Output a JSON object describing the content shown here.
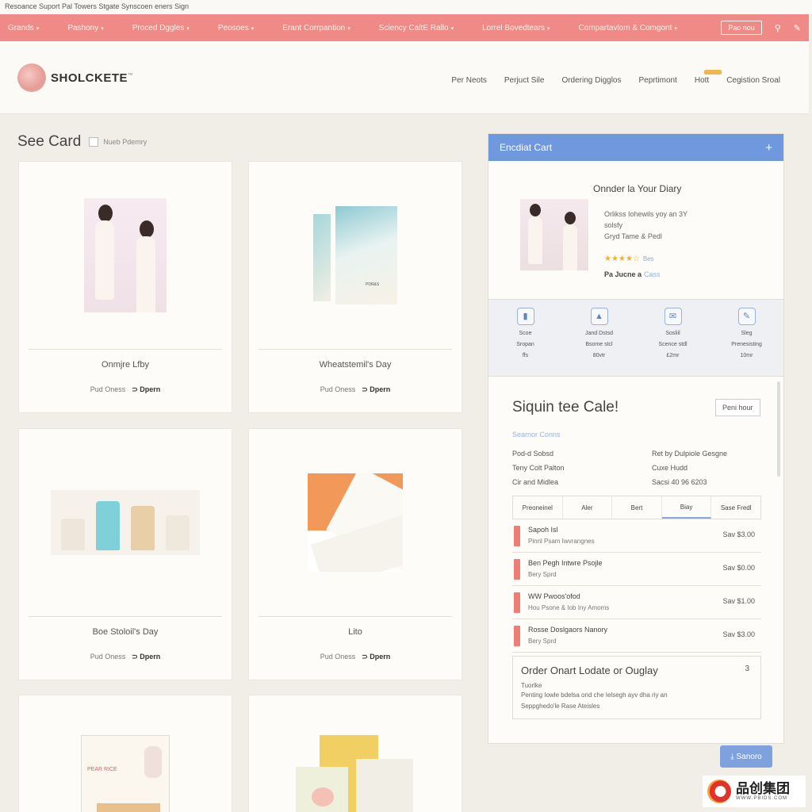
{
  "top_strip": "Resoance Suport Pal Towers Stgate Synscoen eners Sign",
  "nav": {
    "items": [
      "Grands",
      "Pashony",
      "Proced Dggles",
      "Peosoes",
      "Erant Corrpantion",
      "Sciency CaltE Rallo",
      "Lorrel Bovedtears",
      "Compartavlom & Comgont"
    ],
    "button": "Pao nou"
  },
  "header": {
    "logo": "SHOLCKETE",
    "links": [
      "Per Neots",
      "Perjuct Sile",
      "Ordering Digglos",
      "Peprtimont",
      "Hott",
      "Cegistion Sroal"
    ]
  },
  "section": {
    "title": "See Card",
    "subtitle": "Nueb Pdemry"
  },
  "cards": [
    {
      "title": "Onmjre Lfby",
      "foot": "Pud Oness",
      "foot_b": "Dpern"
    },
    {
      "title": "Wheatstemil's Day",
      "foot": "Pud Oness",
      "foot_b": "Dpern"
    },
    {
      "title": "Boe Stoloil's Day",
      "foot": "Pud Oness",
      "foot_b": "Dpern"
    },
    {
      "title": "Lito",
      "foot": "Pud Oness",
      "foot_b": "Dpern"
    },
    {
      "title": "",
      "foot": "",
      "foot_b": ""
    },
    {
      "title": "",
      "foot": "",
      "foot_b": ""
    }
  ],
  "card_misc": {
    "wedding_text": "PDR&S",
    "book_text": "PEAR RICE"
  },
  "panel": {
    "header": "Encdiat Cart",
    "order_title": "Onnder la Your Diary",
    "order_lines": [
      "Orlikss Iohewils yoy an 3Y",
      "solsfy",
      "Gryd Tame & Pedl"
    ],
    "stars": "★★★★☆",
    "rating_note": "Bes",
    "price_label": "Pa Jucne a",
    "price_value": "Cass",
    "steps": [
      {
        "icon": "document-icon",
        "glyph": "▮",
        "l1": "Scoe",
        "l2": "Sropan",
        "l3": "ffs"
      },
      {
        "icon": "image-icon",
        "glyph": "▲",
        "l1": "Jand Dstsd",
        "l2": "Bsome stcl",
        "l3": "80vtr"
      },
      {
        "icon": "mail-icon",
        "glyph": "✉",
        "l1": "Sosliil",
        "l2": "Scence stdl",
        "l3": "£2mr"
      },
      {
        "icon": "tool-icon",
        "glyph": "✎",
        "l1": "Sleg",
        "l2": "Prenesisting",
        "l3": "10mr"
      }
    ],
    "signup": {
      "title": "Siquin tee Cale!",
      "button": "Peni hour",
      "sub": "Searnor Conns",
      "left_rows": [
        "Pod-d Sobsd",
        "Teny Colt Palton",
        "Cir and Midlea"
      ],
      "right_rows": [
        "Ret by Dulpiole Gesgne",
        "Cuxe Hudd",
        "Sacsi 40 96 6203"
      ],
      "tabs": [
        "Preoneinel",
        "Aler",
        "Bert",
        "Biay",
        "Sase Fredl"
      ],
      "items": [
        {
          "name": "Sapoh Isl",
          "desc": "Pinnl Psam Iwvrangnes",
          "price": "Sav $3.00"
        },
        {
          "name": "Ben Pegh Intwre Psojle",
          "desc": "Bery Sprd",
          "price": "Sav $0.00"
        },
        {
          "name": "WW Pwoos'ofod",
          "desc": "Hou Psone & Iob Iny Amoms",
          "price": "Sav $1.00"
        },
        {
          "name": "Rosse Doslgaors Nanory",
          "desc": "Bery Sprd",
          "price": "Sav $3.00"
        }
      ],
      "update_title": "Order Onart Lodate or Ouglay",
      "update_num": "3",
      "update_lines": [
        "Tuorlke",
        "Penting Iowle bdelsa ond che Ielsegh ayv dha riy an",
        "Seppghedo'le Rase Ateisles"
      ]
    },
    "submit": "Sanoro"
  },
  "watermark": {
    "cn": "品创集团",
    "url": "WWW.PBIDS.COM"
  },
  "colors": {
    "nav": "#ef8a86",
    "panel_header": "#6f98de",
    "accent_orange": "#f2995a",
    "star": "#f0b12b"
  }
}
